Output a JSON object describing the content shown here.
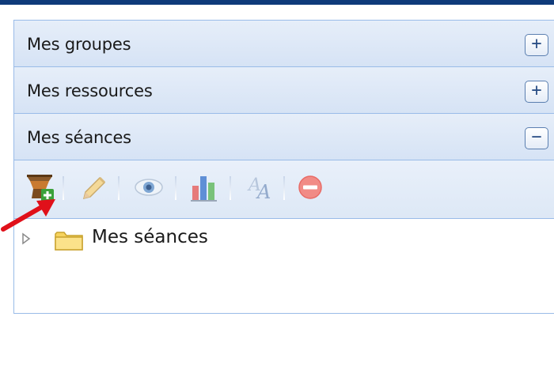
{
  "accordion": {
    "groups_label": "Mes groupes",
    "resources_label": "Mes ressources",
    "sessions_label": "Mes séances",
    "expand_symbol": "+",
    "collapse_symbol": "−"
  },
  "toolbar": {
    "icons": [
      "add-session-icon",
      "edit-pencil-icon",
      "view-eye-icon",
      "stats-bar-chart-icon",
      "font-style-icon",
      "delete-icon"
    ]
  },
  "tree": {
    "root_label": "Mes séances"
  },
  "colors": {
    "header_bg": "#dbe6f6",
    "border": "#99bbe8",
    "annotation_arrow": "#e0101a"
  }
}
